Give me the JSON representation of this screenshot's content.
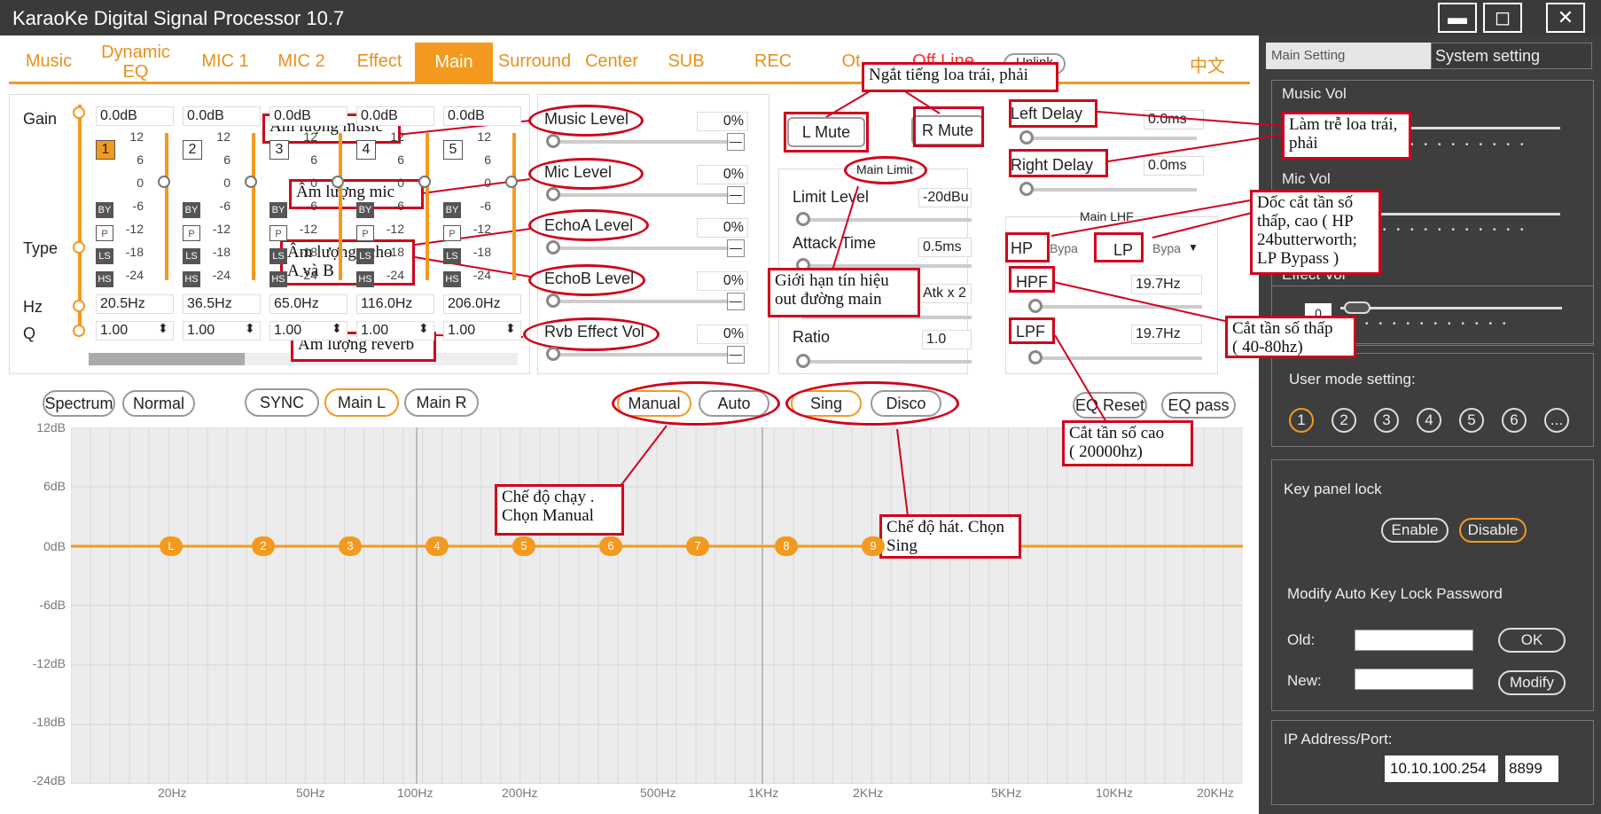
{
  "window": {
    "title": "KaraoKe Digital Signal Processor 10.7"
  },
  "tabs": [
    "Music",
    "Dynamic EQ",
    "MIC 1",
    "MIC 2",
    "Effect",
    "Main",
    "Surround",
    "Center",
    "SUB",
    "REC",
    "Ot",
    "Off Line",
    "Unlink",
    "中文"
  ],
  "eq_bands": {
    "gain_label": "Gain",
    "type_label": "Type",
    "hz_label": "Hz",
    "q_label": "Q",
    "bands": [
      {
        "num": "1",
        "gain": "0.0dB",
        "hz": "20.5Hz",
        "q": "1.00"
      },
      {
        "num": "2",
        "gain": "0.0dB",
        "hz": "36.5Hz",
        "q": "1.00"
      },
      {
        "num": "3",
        "gain": "0.0dB",
        "hz": "65.0Hz",
        "q": "1.00"
      },
      {
        "num": "4",
        "gain": "0.0dB",
        "hz": "116.0Hz",
        "q": "1.00"
      },
      {
        "num": "5",
        "gain": "0.0dB",
        "hz": "206.0Hz",
        "q": "1.00"
      }
    ],
    "scale": [
      "12",
      "6",
      "0",
      "-6",
      "-12",
      "-18",
      "-24"
    ],
    "type_tags": [
      "BY",
      "P",
      "LS",
      "HS"
    ]
  },
  "levels": [
    {
      "label": "Music Level",
      "value": "0%"
    },
    {
      "label": "Mic Level",
      "value": "0%"
    },
    {
      "label": "EchoA Level",
      "value": "0%"
    },
    {
      "label": "EchoB Level",
      "value": "0%"
    },
    {
      "label": "Rvb Effect Vol",
      "value": "0%"
    }
  ],
  "mute": {
    "l": "L Mute",
    "r": "R Mute"
  },
  "main_limit": {
    "title": "Main Limit",
    "limit_label": "Limit Level",
    "limit_value": "-20dBu",
    "attack_label": "Attack Time",
    "attack_value": "0.5ms",
    "atk_value": "Atk x 2",
    "ratio_label": "Ratio",
    "ratio_value": "1.0"
  },
  "delay": {
    "left_label": "Left Delay",
    "left_value": "0.0ms",
    "right_label": "Right Delay",
    "right_value": "0.0ms"
  },
  "lhf": {
    "title": "Main LHF",
    "hp_label": "HP",
    "hp_value": "Bypa",
    "lp_label": "LP",
    "lp_value": "Bypa",
    "hpf_label": "HPF",
    "hpf_value": "19.7Hz",
    "lpf_label": "LPF",
    "lpf_value": "19.7Hz"
  },
  "graph_buttons": {
    "spectrum": "Spectrum",
    "normal": "Normal",
    "sync": "SYNC",
    "main_l": "Main L",
    "main_r": "Main R",
    "manual": "Manual",
    "auto": "Auto",
    "sing": "Sing",
    "disco": "Disco",
    "eq_reset": "EQ Reset",
    "eq_pass": "EQ pass"
  },
  "graph": {
    "y_ticks": [
      "12dB",
      "6dB",
      "0dB",
      "-6dB",
      "-12dB",
      "-18dB",
      "-24dB"
    ],
    "x_ticks": [
      "20Hz",
      "50Hz",
      "100Hz",
      "200Hz",
      "500Hz",
      "1KHz",
      "2KHz",
      "5KHz",
      "10KHz",
      "20KHz"
    ],
    "nodes": [
      "L",
      "2",
      "3",
      "4",
      "5",
      "6",
      "7",
      "8",
      "9"
    ]
  },
  "right_panel": {
    "tabs": [
      "Main Setting",
      "System setting"
    ],
    "music_vol": "Music Vol",
    "mic_vol": "Mic Vol",
    "effect_vol": "Effect Vol",
    "effect_value": "0",
    "user_mode": "User mode setting:",
    "modes": [
      "1",
      "2",
      "3",
      "4",
      "5",
      "6",
      "..."
    ],
    "key_lock": "Key panel lock",
    "enable": "Enable",
    "disable": "Disable",
    "modify_title": "Modify Auto Key Lock Password",
    "old": "Old:",
    "new": "New:",
    "ok": "OK",
    "modify": "Modify",
    "ip_title": "IP Address/Port:",
    "ip": "10.10.100.254",
    "port": "8899"
  },
  "annotations": {
    "music": "Âm lượng music",
    "mic": "Âm lượng mic",
    "echo_line1": "Âm lượng echo",
    "echo_line2": "A và B",
    "reverb": "Âm lượng reverb",
    "mute": "Ngắt tiếng loa trái, phải",
    "limit_line1": "Giới hạn tín hiệu",
    "limit_line2": "out đường main",
    "delay_line1": "Làm trễ loa trái,",
    "delay_line2": "phải",
    "slope_line1": "Dốc cắt tần số",
    "slope_line2": "thấp, cao ( HP",
    "slope_line3": "24butterworth;",
    "slope_line4": "LP Bypass )",
    "hpf_line1": "Cắt tần số thấp",
    "hpf_line2": "( 40-80hz)",
    "lpf_line1": "Cắt tần số cao",
    "lpf_line2": "( 20000hz)",
    "mode_line1": "Chế độ chạy .",
    "mode_line2": "Chọn Manual",
    "sing_line1": "Chế độ hát. Chọn",
    "sing_line2": "Sing"
  },
  "colors": {
    "accent": "#f39a1e",
    "annotation": "#d0021b",
    "right_bg": "#3e3e3e"
  }
}
